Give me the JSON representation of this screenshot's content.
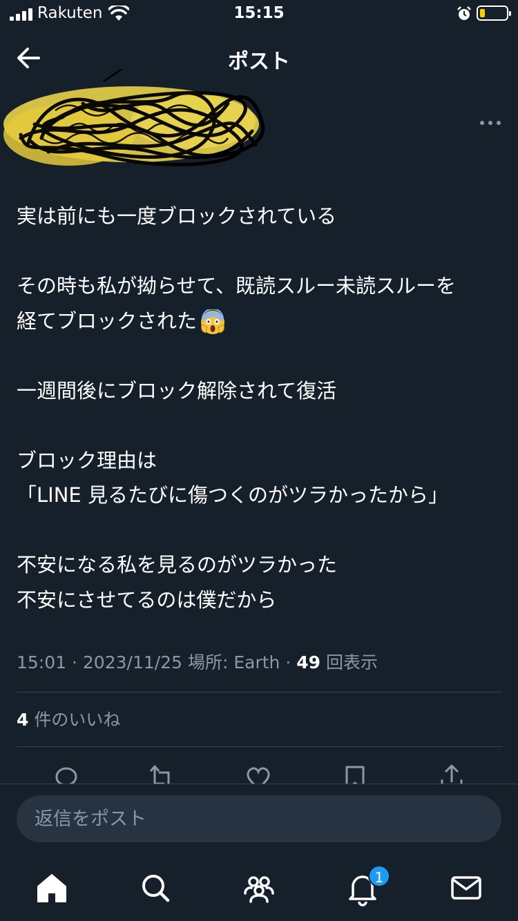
{
  "status_bar": {
    "carrier": "Rakuten",
    "time": "15:15",
    "battery_level": 0.18,
    "battery_color": "#f5d100"
  },
  "header": {
    "title": "ポスト",
    "back_icon": "arrow-left-icon"
  },
  "post": {
    "more_icon": "ellipsis-icon",
    "paragraphs": [
      [
        "実は前にも一度ブロックされている"
      ],
      [
        "その時も私が拗らせて、既読スルー未読スルーを",
        "経てブロックされた"
      ],
      [
        "一週間後にブロック解除されて復活"
      ],
      [
        "ブロック理由は",
        "「LINE 見るたびに傷つくのがツラかったから」"
      ],
      [
        "不安になる私を見るのがツラかった",
        "不安にさせてるのは僕だから"
      ]
    ],
    "emoji": "face-screaming-in-fear-icon",
    "meta": {
      "time": "15:01",
      "date": "2023/11/25",
      "location": "場所: Earth",
      "views_count": "49",
      "views_label": "回表示"
    },
    "likes": {
      "count": "4",
      "label": "件のいいね"
    },
    "actions": [
      "reply-icon",
      "repost-icon",
      "like-icon",
      "bookmark-icon",
      "share-icon"
    ]
  },
  "reply": {
    "placeholder": "返信をポスト"
  },
  "tabbar": {
    "items": [
      "home-icon",
      "search-icon",
      "communities-icon",
      "notifications-icon",
      "messages-icon"
    ],
    "notification_badge": "1"
  },
  "colors": {
    "background": "#15202b",
    "muted_text": "#8b98a5",
    "divider": "#38444d",
    "accent": "#1d9bf0"
  }
}
